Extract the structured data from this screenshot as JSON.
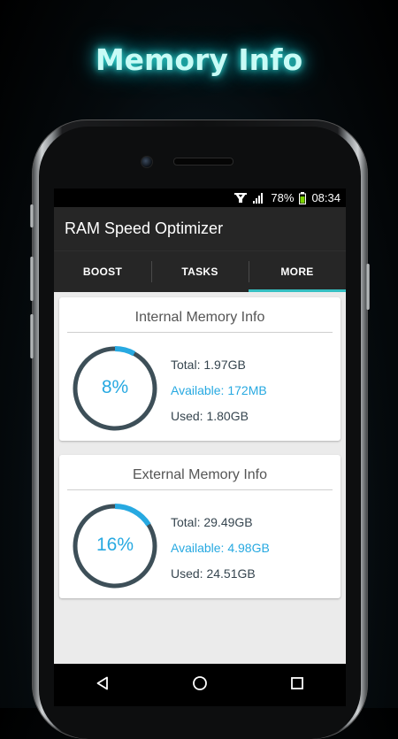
{
  "promo_title": "Memory Info",
  "status_bar": {
    "battery_percent": "78%",
    "time": "08:34",
    "icons": [
      "notification-icon",
      "signal-icon",
      "battery-icon"
    ]
  },
  "app_bar": {
    "title": "RAM Speed Optimizer"
  },
  "tabs": [
    {
      "label": "BOOST",
      "active": false
    },
    {
      "label": "TASKS",
      "active": false
    },
    {
      "label": "MORE",
      "active": true
    }
  ],
  "internal": {
    "title": "Internal Memory Info",
    "percent_label": "8%",
    "percent_value": 8,
    "total": "Total: 1.97GB",
    "available": "Available: 172MB",
    "used": "Used: 1.80GB"
  },
  "external": {
    "title": "External Memory Info",
    "percent_label": "16%",
    "percent_value": 16,
    "total": "Total: 29.49GB",
    "available": "Available: 4.98GB",
    "used": "Used: 24.51GB"
  },
  "nav_bar": {
    "icons": [
      "back-icon",
      "home-icon",
      "recents-icon"
    ]
  },
  "colors": {
    "accent": "#27a9e1",
    "ring_track": "#3d4f58",
    "tab_indicator": "#36bfc2",
    "app_bar": "#262626"
  }
}
